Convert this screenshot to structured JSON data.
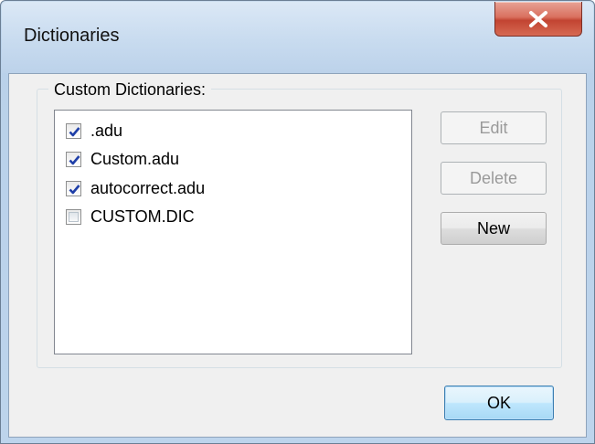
{
  "window": {
    "title": "Dictionaries"
  },
  "group": {
    "label": "Custom Dictionaries:"
  },
  "dictionaries": [
    {
      "label": ".adu",
      "checked": true
    },
    {
      "label": "Custom.adu",
      "checked": true
    },
    {
      "label": "autocorrect.adu",
      "checked": true
    },
    {
      "label": "CUSTOM.DIC",
      "checked": false
    }
  ],
  "buttons": {
    "edit": "Edit",
    "delete": "Delete",
    "new": "New",
    "ok": "OK"
  },
  "colors": {
    "close_button": "#c24432",
    "check_mark": "#1f3fa8",
    "default_button_border": "#3c7fb1"
  },
  "icons": {
    "close": "close-icon",
    "check": "checkmark-icon"
  }
}
